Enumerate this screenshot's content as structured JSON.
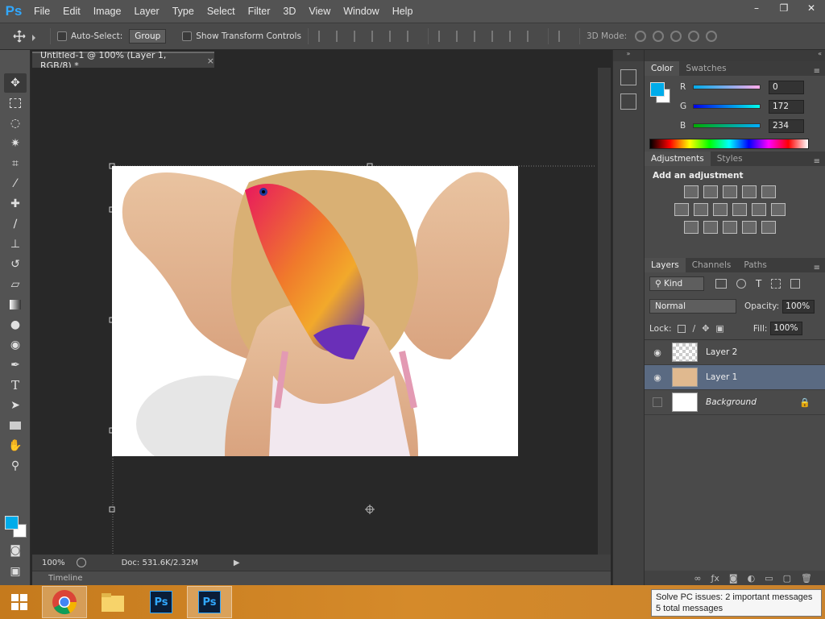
{
  "menu": [
    "File",
    "Edit",
    "Image",
    "Layer",
    "Type",
    "Select",
    "Filter",
    "3D",
    "View",
    "Window",
    "Help"
  ],
  "app_logo": "Ps",
  "window_controls": [
    "–",
    "❐",
    "✕"
  ],
  "options": {
    "auto_select_label": "Auto-Select:",
    "auto_select_value": "Group",
    "transform_label": "Show Transform Controls",
    "mode3d_label": "3D Mode:"
  },
  "document": {
    "tab_title": "Untitled-1 @ 100% (Layer 1, RGB/8) *",
    "tab_close": "×",
    "zoom": "100%",
    "doc_size": "Doc: 531.6K/2.32M",
    "timeline_label": "Timeline"
  },
  "color_panel": {
    "tabs": [
      "Color",
      "Swatches"
    ],
    "foreground": "#00acea",
    "channels": [
      {
        "name": "R",
        "value": "0"
      },
      {
        "name": "G",
        "value": "172"
      },
      {
        "name": "B",
        "value": "234"
      }
    ]
  },
  "adjustments_panel": {
    "tabs": [
      "Adjustments",
      "Styles"
    ],
    "heading": "Add an adjustment"
  },
  "layers_panel": {
    "tabs": [
      "Layers",
      "Channels",
      "Paths"
    ],
    "kind_label": "Kind",
    "blend_mode": "Normal",
    "opacity_label": "Opacity:",
    "opacity_value": "100%",
    "lock_label": "Lock:",
    "fill_label": "Fill:",
    "fill_value": "100%",
    "layers": [
      {
        "name": "Layer 2",
        "visible": true
      },
      {
        "name": "Layer 1",
        "visible": true,
        "selected": true
      },
      {
        "name": "Background",
        "visible": false,
        "locked": true
      }
    ]
  },
  "taskbar": {
    "tooltip_line1": "Solve PC issues: 2 important messages",
    "tooltip_line2": "5 total messages"
  }
}
